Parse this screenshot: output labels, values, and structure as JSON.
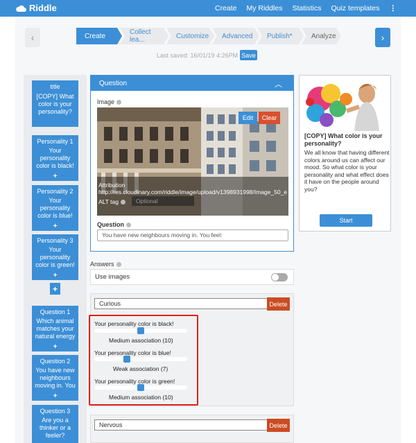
{
  "topbar": {
    "brand": "Riddle",
    "nav": [
      "Create",
      "My Riddles",
      "Statistics",
      "Quiz templates"
    ],
    "more": "⋮"
  },
  "steps": {
    "prev_icon": "‹",
    "next_icon": "›",
    "items": [
      "Create",
      "Collect lea...",
      "Customize",
      "Advanced",
      "Publish*",
      "Analyze"
    ],
    "saved_text": "Last saved: 16/01/19 4:26PM –",
    "save_label": "Save"
  },
  "sidebar": {
    "cards": [
      {
        "title": "title",
        "body": "[COPY] What color is your personality?"
      },
      {
        "title": "Personality 1",
        "body": "Your personality color is black!"
      },
      {
        "title": "Personality 2",
        "body": "Your personality color is blue!"
      },
      {
        "title": "Personality 3",
        "body": "Your personality color is green!"
      },
      {
        "title": "Question 1",
        "body": "Which animal matches your natural energy"
      },
      {
        "title": "Question 2",
        "body": "You have new neighbours moving in. You"
      },
      {
        "title": "Question 3",
        "body": "Are you a thinker or a feeler?"
      }
    ],
    "add_icon": "+"
  },
  "question": {
    "header": "Question",
    "image_label": "Image",
    "edit_label": "Edit",
    "clear_label": "Clear",
    "attribution_label": "Attribution",
    "attribution_url": "http://res.cloudinary.com/riddle/image/upload/v1398931998/Image_50_e",
    "alt_label": "ALT tag",
    "alt_placeholder": "Optional",
    "question_label": "Question",
    "question_value": "You have new neighbours moving in. You feel:"
  },
  "answers": {
    "label": "Answers",
    "use_images": "Use images",
    "items": [
      {
        "value": "Curious",
        "delete": "Delete",
        "associations": [
          {
            "title": "Your personality color is black!",
            "level": "Medium association (10)",
            "fraction": 0.5
          },
          {
            "title": "Your personality color is blue!",
            "level": "Weak association (7)",
            "fraction": 0.35
          },
          {
            "title": "Your personality color is green!",
            "level": "Medium association (10)",
            "fraction": 0.5
          }
        ]
      },
      {
        "value": "Nervous",
        "delete": "Delete"
      }
    ]
  },
  "preview": {
    "title": "[COPY] What color is your personality?",
    "text": "We all know that having different colors around us can affect our mood. So what color is your personality and what effect does it have on the people around you?",
    "start": "Start"
  },
  "colors": {
    "accent": "#3c8fd6",
    "danger": "#d9502d",
    "highlight": "#e0221a"
  }
}
